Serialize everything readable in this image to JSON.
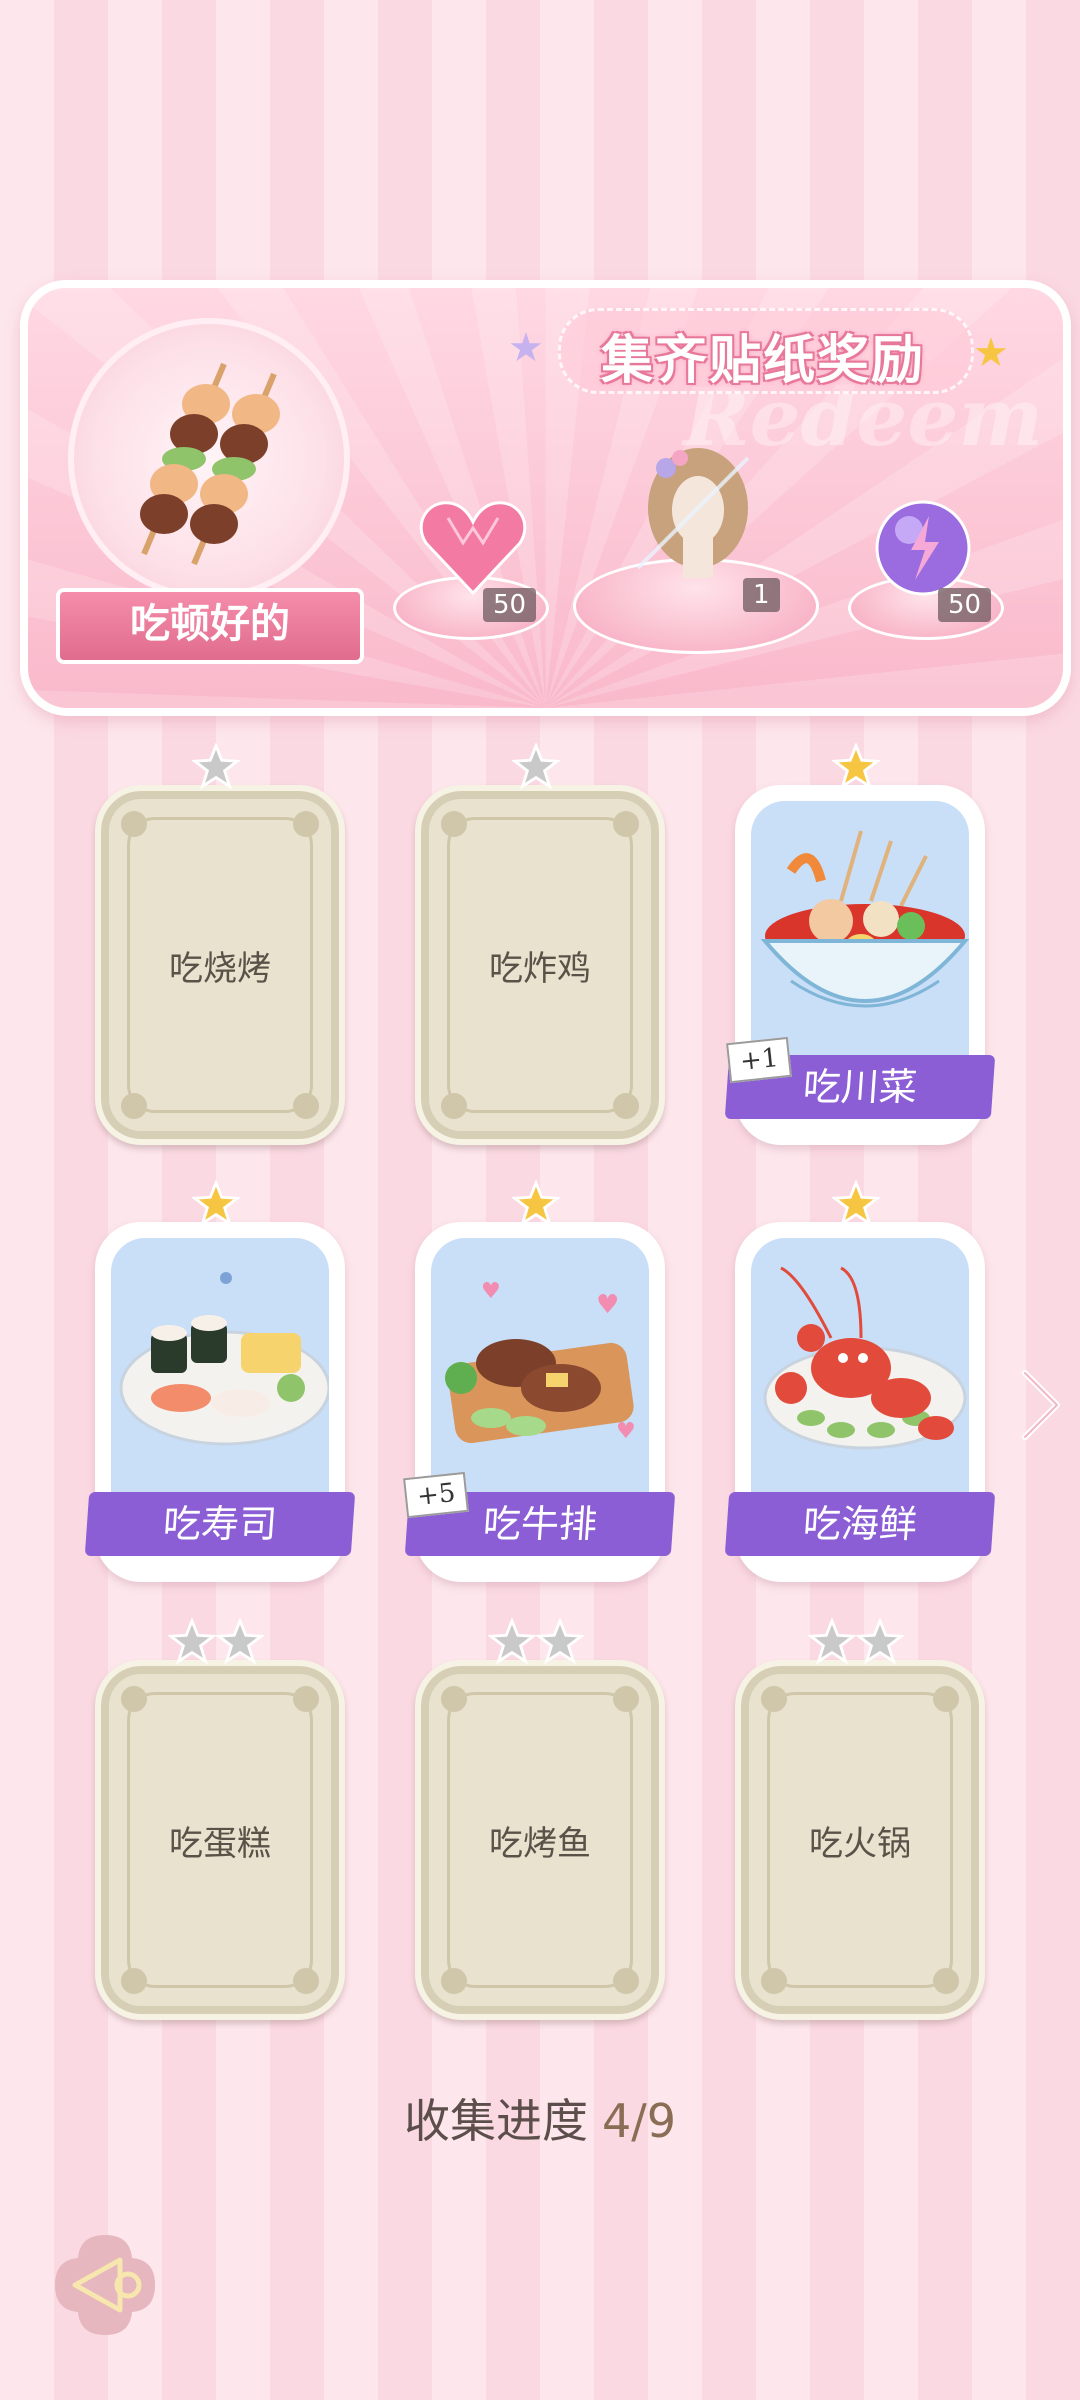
{
  "banner": {
    "title": "集齐贴纸奖励",
    "watermark": "Redeem",
    "sticker_name": "吃顿好的",
    "rewards": [
      {
        "icon": "pink-heart-gem-icon",
        "count": "50"
      },
      {
        "icon": "outfit-hair-icon",
        "count": "1"
      },
      {
        "icon": "purple-energy-orb-icon",
        "count": "50"
      }
    ]
  },
  "cards": [
    {
      "label": "吃烧烤",
      "state": "locked",
      "stars": 1,
      "star_color": "silver"
    },
    {
      "label": "吃炸鸡",
      "state": "locked",
      "stars": 1,
      "star_color": "silver"
    },
    {
      "label": "吃川菜",
      "state": "unlocked",
      "stars": 1,
      "star_color": "gold",
      "bonus": "+1"
    },
    {
      "label": "吃寿司",
      "state": "unlocked",
      "stars": 1,
      "star_color": "gold"
    },
    {
      "label": "吃牛排",
      "state": "unlocked",
      "stars": 1,
      "star_color": "gold",
      "bonus": "+5"
    },
    {
      "label": "吃海鲜",
      "state": "unlocked",
      "stars": 1,
      "star_color": "gold"
    },
    {
      "label": "吃蛋糕",
      "state": "locked",
      "stars": 2,
      "star_color": "silver"
    },
    {
      "label": "吃烤鱼",
      "state": "locked",
      "stars": 2,
      "star_color": "silver"
    },
    {
      "label": "吃火锅",
      "state": "locked",
      "stars": 2,
      "star_color": "silver"
    }
  ],
  "progress": {
    "label": "收集进度",
    "value": "4/9"
  },
  "colors": {
    "accent_purple": "#8b5ed6",
    "gold_star": "#f6c542",
    "silver_star": "#c9c9c9",
    "pink_bg": "#fde6ec"
  },
  "icons": {
    "back": "back-arrow-icon",
    "next": "chevron-right-icon"
  }
}
